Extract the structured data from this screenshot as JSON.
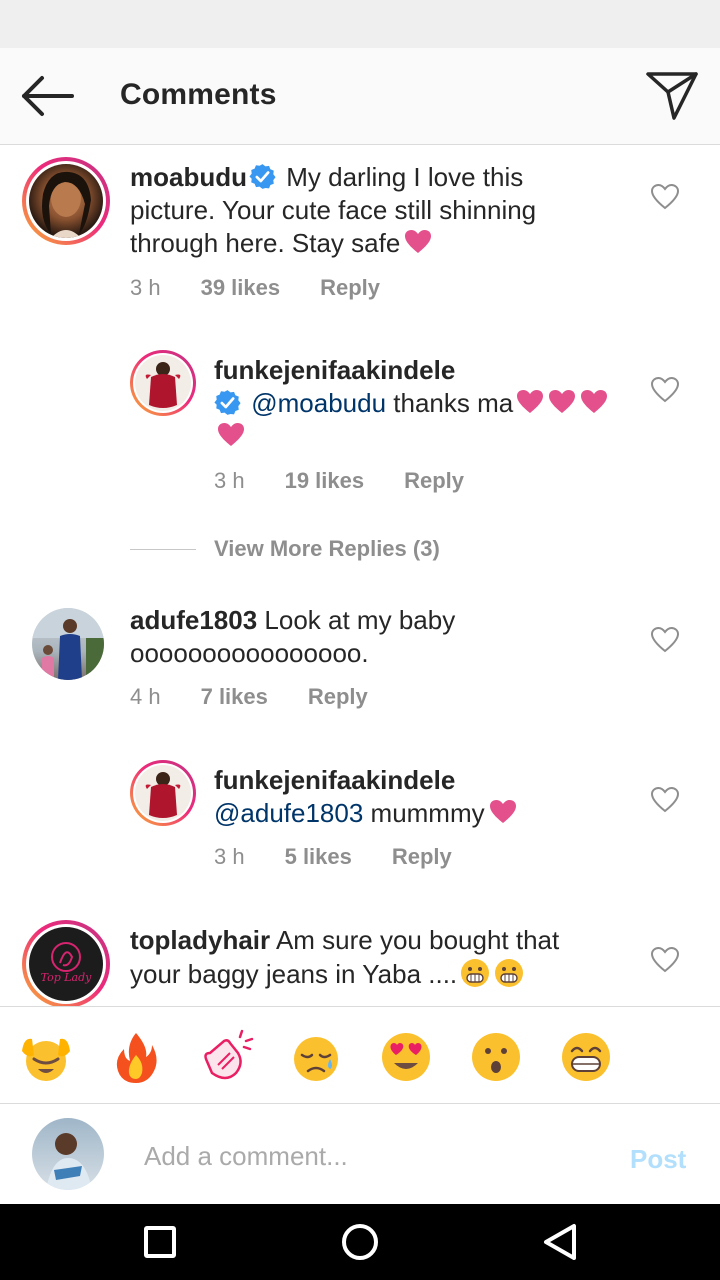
{
  "header": {
    "title": "Comments",
    "back_icon": "arrow-left-icon",
    "send_icon": "paper-plane-icon"
  },
  "comments": [
    {
      "username": "moabudu",
      "verified": true,
      "text": "My darling I love this picture. Your cute face still shinning through here. Stay safe",
      "time": "3 h",
      "likes": "39 likes",
      "reply": "Reply"
    },
    {
      "username": "funkejenifaakindele",
      "verified": true,
      "mention": "@moabudu",
      "text": "thanks ma",
      "time": "3 h",
      "likes": "19 likes",
      "reply": "Reply"
    },
    {
      "username": "adufe1803",
      "verified": false,
      "text": "Look at my baby oooooooooooooooo.",
      "time": "4 h",
      "likes": "7 likes",
      "reply": "Reply"
    },
    {
      "username": "funkejenifaakindele",
      "verified": false,
      "mention": "@adufe1803",
      "text": "mummmy",
      "time": "3 h",
      "likes": "5 likes",
      "reply": "Reply"
    },
    {
      "username": "topladyhair",
      "verified": false,
      "text": "Am sure you bought that your baggy jeans in Yaba ....",
      "avatar_text": "Top Lady"
    }
  ],
  "view_more_replies": "View More Replies (3)",
  "quick_emojis": [
    "raising-hands-icon",
    "fire-icon",
    "clapping-hands-icon",
    "crying-face-icon",
    "heart-eyes-icon",
    "surprised-face-icon",
    "grinning-face-icon"
  ],
  "composer": {
    "placeholder": "Add a comment...",
    "post_label": "Post"
  },
  "colors": {
    "accent_blue": "#3897f0",
    "mention_blue": "#003569",
    "muted_gray": "#8e8e8e",
    "post_disabled": "#b2dffc",
    "story_ring_start": "#f9b233",
    "story_ring_end": "#c13584",
    "heart_pink": "#e4508c"
  }
}
